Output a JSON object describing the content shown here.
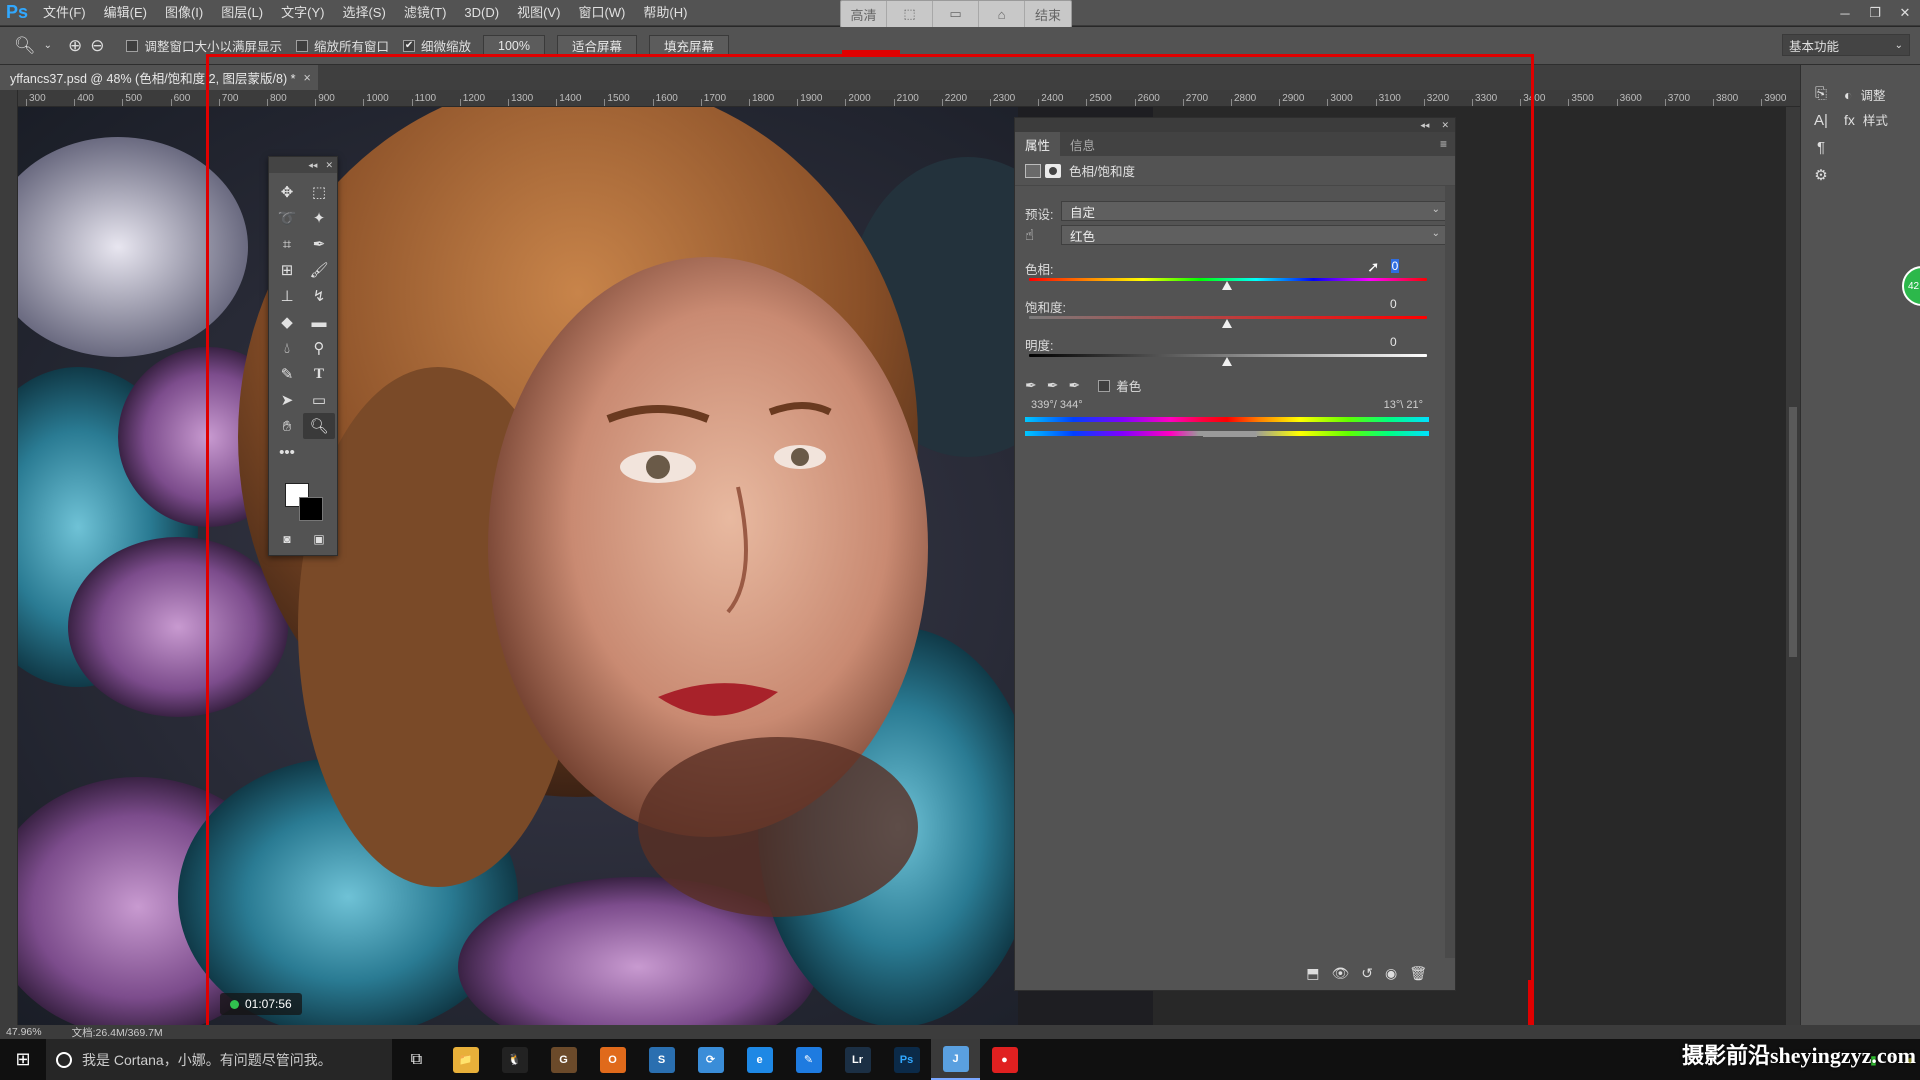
{
  "app": {
    "logo": "Ps"
  },
  "menu": [
    "文件(F)",
    "编辑(E)",
    "图像(I)",
    "图层(L)",
    "文字(Y)",
    "选择(S)",
    "滤镜(T)",
    "3D(D)",
    "视图(V)",
    "窗口(W)",
    "帮助(H)"
  ],
  "recorder_pill": {
    "left_label": "高清",
    "right_label": "结束"
  },
  "options_bar": {
    "resize_windows_label": "调整窗口大小以满屏显示",
    "zoom_all_label": "缩放所有窗口",
    "scrubby_zoom_label": "细微缩放",
    "zoom_value": "100%",
    "fit_screen_label": "适合屏幕",
    "fill_screen_label": "填充屏幕",
    "workspace": "基本功能"
  },
  "document_tab": {
    "title": "yffancs37.psd @ 48% (色相/饱和度 2, 图层蒙版/8) *"
  },
  "ruler_ticks": [
    "300",
    "400",
    "500",
    "600",
    "700",
    "800",
    "900",
    "1000",
    "1100",
    "1200",
    "1300",
    "1400",
    "1500",
    "1600",
    "1700",
    "1800",
    "1900",
    "2000",
    "2100",
    "2200",
    "2300",
    "2400",
    "2500",
    "2600",
    "2700",
    "2800",
    "2900",
    "3000",
    "3100",
    "3200",
    "3300",
    "3400",
    "3500",
    "3600",
    "3700",
    "3800",
    "3900"
  ],
  "timer": "01:07:56",
  "properties_panel": {
    "tabs": [
      "属性",
      "信息"
    ],
    "title": "色相/饱和度",
    "preset_label": "预设:",
    "preset_value": "自定",
    "channel_value": "红色",
    "hue_label": "色相:",
    "hue_value": "0",
    "saturation_label": "饱和度:",
    "saturation_value": "0",
    "lightness_label": "明度:",
    "lightness_value": "0",
    "colorize_label": "着色",
    "range_left": "339°/ 344°",
    "range_right": "13°\\ 21°"
  },
  "dock": {
    "adjust_label": "调整",
    "styles_label": "样式",
    "badge": "42"
  },
  "status_bar": {
    "zoom": "47.96%",
    "doc_info": "文档:26.4M/369.7M"
  },
  "taskbar": {
    "cortana_text": "我是 Cortana，小娜。有问题尽管问我。",
    "apps": [
      {
        "name": "file-explorer",
        "label": "📁",
        "color": "#e8b03a"
      },
      {
        "name": "qq",
        "label": "🐧",
        "color": "#222222"
      },
      {
        "name": "game",
        "label": "G",
        "color": "#6b4a2a"
      },
      {
        "name": "office",
        "label": "O",
        "color": "#e06a1b"
      },
      {
        "name": "app-blue",
        "label": "S",
        "color": "#2a6fb0"
      },
      {
        "name": "app-sync",
        "label": "⟳",
        "color": "#3a8dd8"
      },
      {
        "name": "browser",
        "label": "e",
        "color": "#1e88e5"
      },
      {
        "name": "app-pen",
        "label": "✎",
        "color": "#1e7be0"
      },
      {
        "name": "lightroom",
        "label": "Lr",
        "color": "#1b2f44"
      },
      {
        "name": "photoshop",
        "label": "Ps",
        "color": "#0b2a48"
      },
      {
        "name": "notes",
        "label": "J",
        "color": "#5aa0e0"
      },
      {
        "name": "recorder",
        "label": "●",
        "color": "#e02020"
      }
    ]
  },
  "watermark": "摄影前沿sheyingzyz.com"
}
